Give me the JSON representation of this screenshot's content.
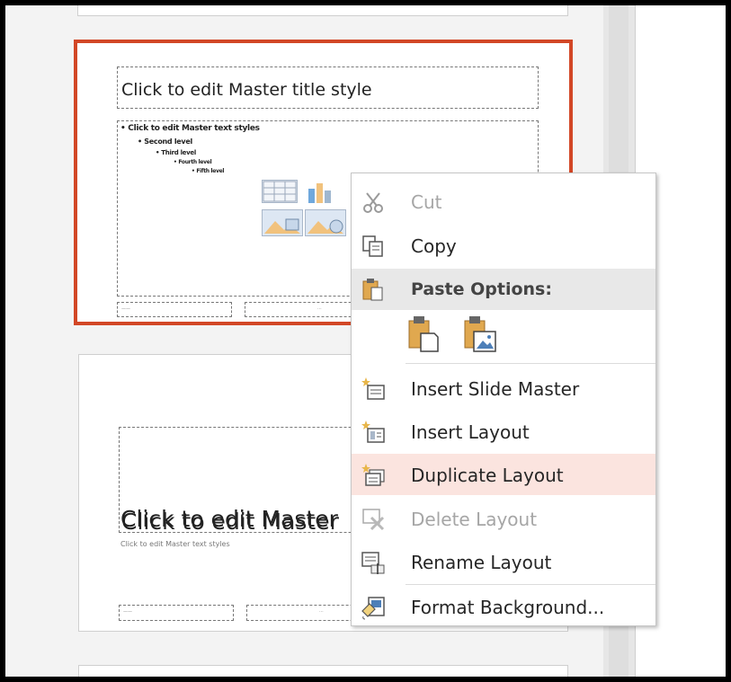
{
  "master_slide": {
    "title": "Click to edit Master title style",
    "levels": [
      "• Click to edit Master text styles",
      "• Second level",
      "• Third level",
      "• Fourth level",
      "• Fifth level"
    ]
  },
  "layout_slide": {
    "title": "Click to edit Master",
    "subtitle": "Click to edit Master text styles"
  },
  "context_menu": {
    "cut": "Cut",
    "copy": "Copy",
    "paste_options": "Paste Options:",
    "insert_slide_master": "Insert Slide Master",
    "insert_layout": "Insert Layout",
    "duplicate_layout": "Duplicate Layout",
    "delete_layout": "Delete Layout",
    "rename_layout": "Rename Layout",
    "format_background": "Format Background...",
    "hovered_item": "Duplicate Layout"
  },
  "icons": {
    "cut": "scissors-icon",
    "copy": "copy-icon",
    "paste": "clipboard-icon",
    "paste_keep_text": "paste-keep-text-icon",
    "paste_picture": "paste-picture-icon",
    "insert_slide_master": "insert-slide-master-icon",
    "insert_layout": "insert-layout-icon",
    "duplicate_layout": "duplicate-layout-icon",
    "delete_layout": "delete-layout-icon",
    "rename_layout": "rename-layout-icon",
    "format_background": "format-background-icon"
  },
  "colors": {
    "selection_border": "#d24726",
    "hover_background": "#fbe4df",
    "paste_header_background": "#e8e8e8"
  }
}
